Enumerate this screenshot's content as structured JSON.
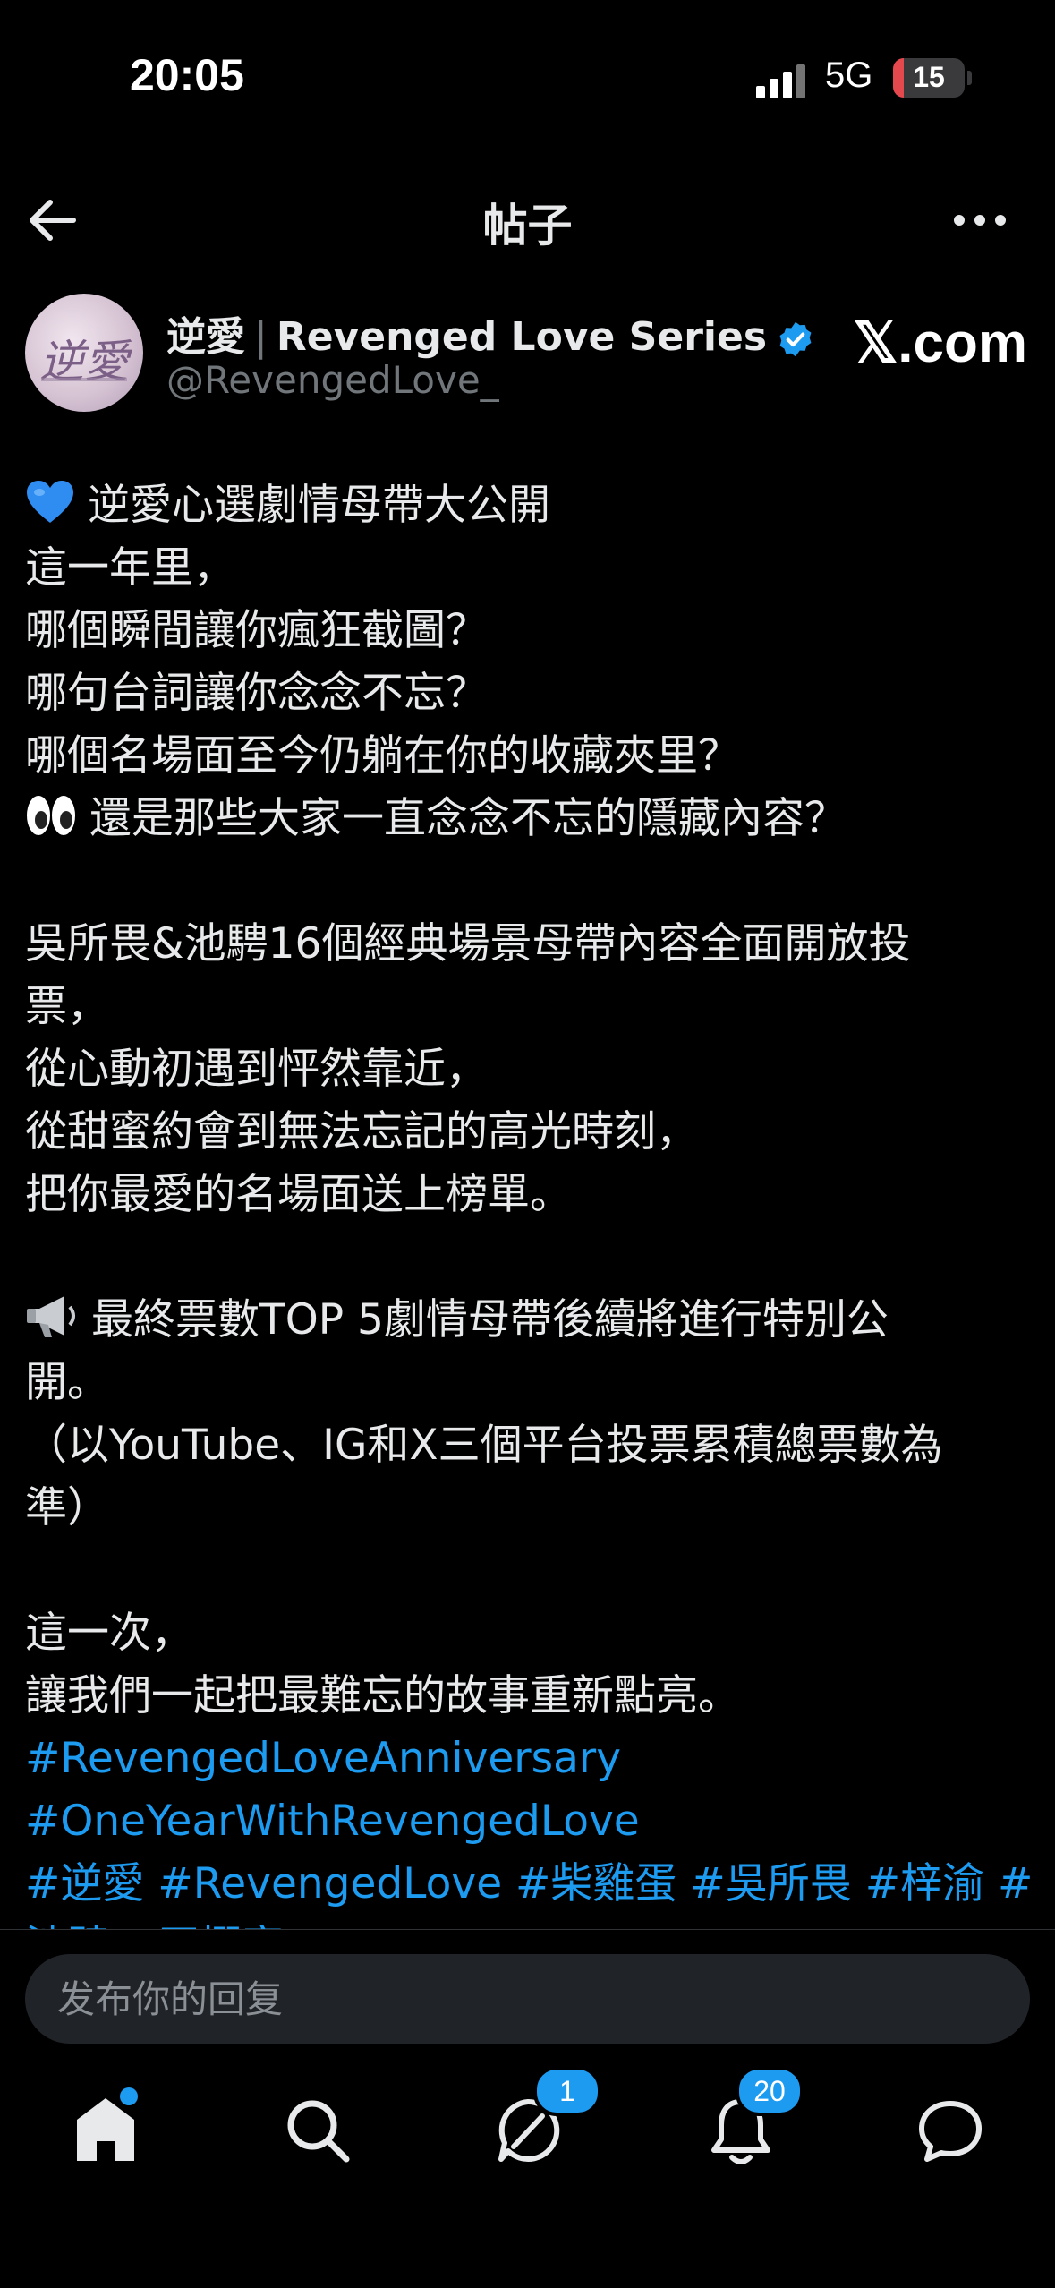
{
  "status_bar": {
    "time": "20:05",
    "network": "5G",
    "battery_percent": "15",
    "battery_level": 0.15
  },
  "header": {
    "title": "帖子"
  },
  "author": {
    "name": "逆愛",
    "name_en": "Revenged Love Series",
    "handle": "@RevengedLove_",
    "avatar_text": "逆愛",
    "verified": true
  },
  "watermark": "𝕏.com",
  "post": {
    "lines": [
      {
        "text": "逆愛心選劇情母帶大公開",
        "type": "text",
        "emoji": "blue-heart-icon"
      },
      {
        "text": "這一年里，",
        "type": "text"
      },
      {
        "text": "哪個瞬間讓你瘋狂截圖？",
        "type": "text"
      },
      {
        "text": "哪句台詞讓你念念不忘？",
        "type": "text"
      },
      {
        "text": "哪個名場面至今仍躺在你的收藏夾里？",
        "type": "text"
      },
      {
        "text": "還是那些大家一直念念不忘的隱藏內容？",
        "type": "text",
        "emoji": "eyes-icon"
      },
      {
        "text": "",
        "type": "blank"
      },
      {
        "text": "吳所畏&池騁16個經典場景母帶內容全面開放投",
        "type": "text"
      },
      {
        "text": "票，",
        "type": "text"
      },
      {
        "text": "從心動初遇到怦然靠近，",
        "type": "text"
      },
      {
        "text": "從甜蜜約會到無法忘記的高光時刻，",
        "type": "text"
      },
      {
        "text": "把你最愛的名場面送上榜單。",
        "type": "text"
      },
      {
        "text": "",
        "type": "blank"
      },
      {
        "text": "最終票數TOP 5劇情母帶後續將進行特別公",
        "type": "text",
        "emoji": "megaphone-icon"
      },
      {
        "text": "開。",
        "type": "text"
      },
      {
        "text": "（以YouTube、IG和X三個平台投票累積總票數為",
        "type": "text"
      },
      {
        "text": "準）",
        "type": "text"
      },
      {
        "text": "",
        "type": "blank"
      },
      {
        "text": "這一次，",
        "type": "text"
      },
      {
        "text": "讓我們一起把最難忘的故事重新點亮。",
        "type": "text"
      },
      {
        "text": "#RevengedLoveAnniversary",
        "type": "hashtag"
      },
      {
        "text": "#OneYearWithRevengedLove",
        "type": "hashtag"
      },
      {
        "text": "#逆愛 #RevengedLove #柴雞蛋 #吳所畏 #梓渝 #",
        "type": "hashtag"
      },
      {
        "text": "池騁 #田栩寧",
        "type": "hashtag"
      }
    ]
  },
  "reply": {
    "placeholder": "发布你的回复"
  },
  "nav": {
    "home": {
      "label": "home",
      "has_dot": true
    },
    "search": {
      "label": "search"
    },
    "grok": {
      "label": "grok",
      "badge": "1"
    },
    "notifications": {
      "label": "notifications",
      "badge": "20"
    },
    "messages": {
      "label": "messages"
    }
  },
  "colors": {
    "accent": "#1d9bf0",
    "background": "#000000",
    "text": "#e7e9ea",
    "muted": "#71767b"
  }
}
